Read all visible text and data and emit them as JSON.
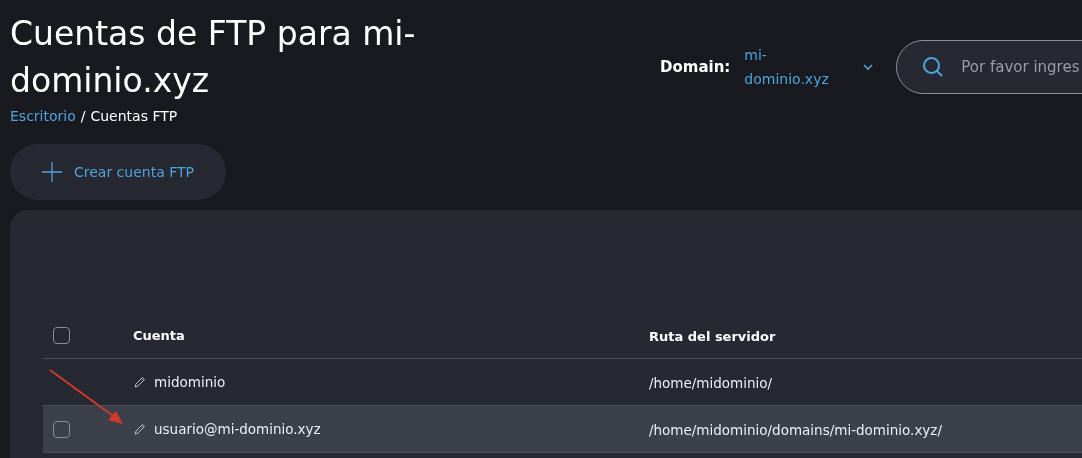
{
  "header": {
    "title": "Cuentas de FTP para mi-dominio.xyz",
    "breadcrumb_separator": "/",
    "breadcrumb": [
      {
        "label": "Escritorio",
        "link": true
      },
      {
        "label": "Cuentas FTP",
        "link": false
      }
    ]
  },
  "domain": {
    "label": "Domain:",
    "value": "mi-dominio.xyz"
  },
  "search": {
    "placeholder": "Por favor ingres"
  },
  "create_button": {
    "label": "Crear cuenta FTP"
  },
  "table": {
    "header_checked": false,
    "columns": [
      "Cuenta",
      "Ruta del servidor"
    ],
    "rows": [
      {
        "account": "midominio",
        "path": "/home/midominio/",
        "highlighted": false
      },
      {
        "account": "usuario@mi-dominio.xyz",
        "path": "/home/midominio/domains/mi-dominio.xyz/",
        "highlighted": true,
        "checked": false
      }
    ]
  }
}
